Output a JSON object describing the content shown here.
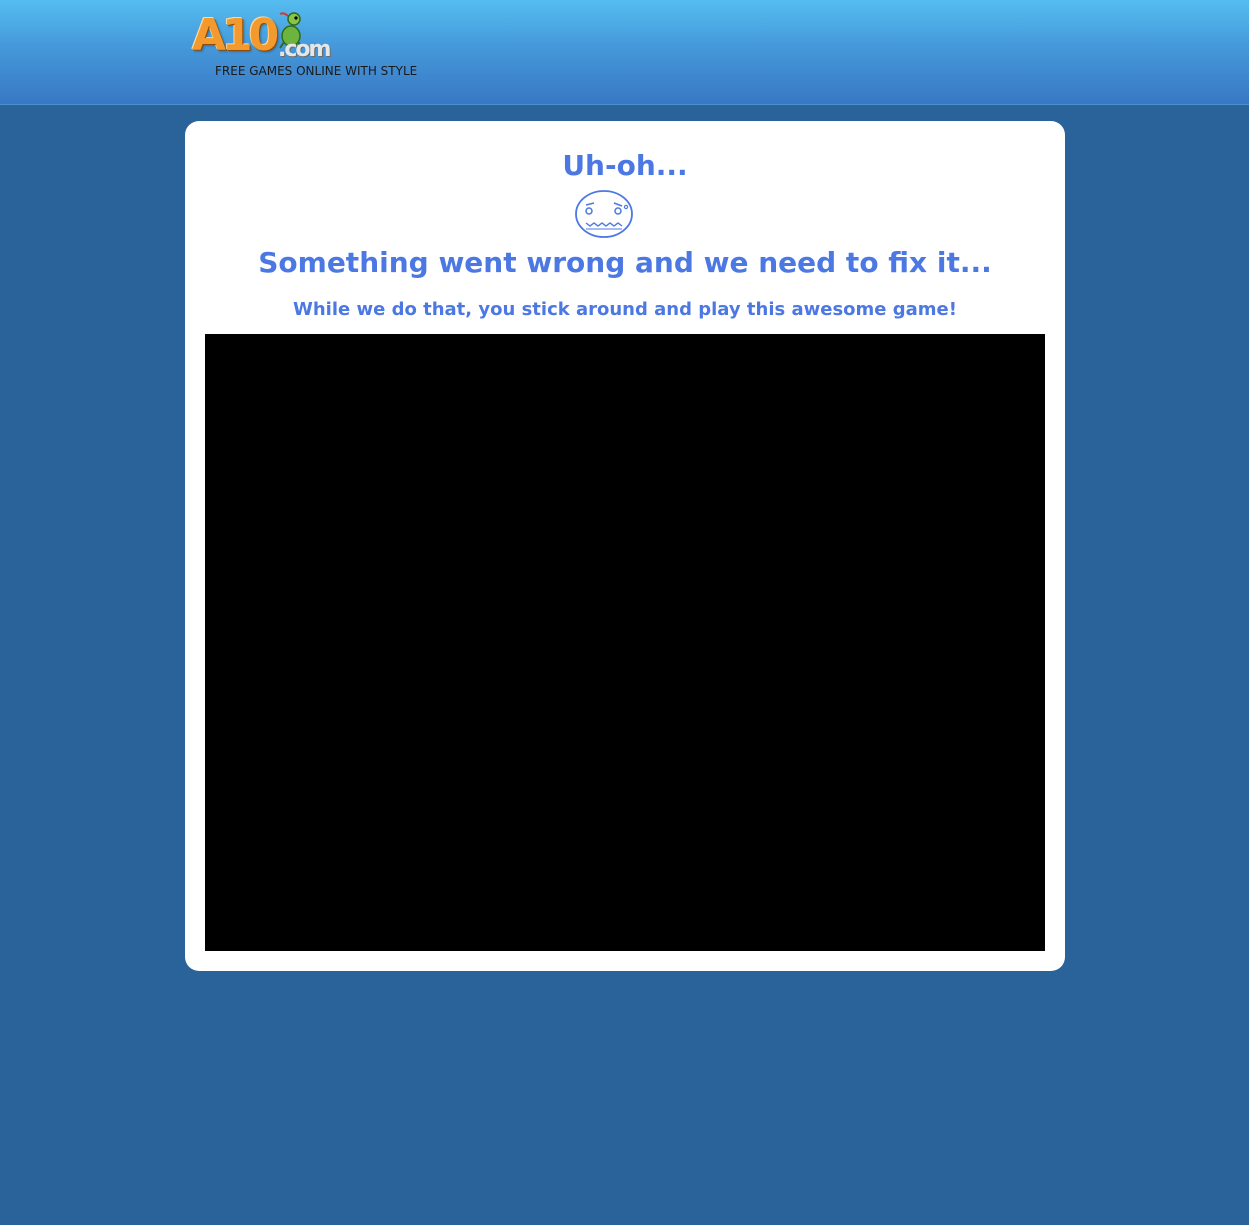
{
  "header": {
    "logo": {
      "name": "A10",
      "suffix": ".com",
      "mascot_icon": "turtle-mascot-icon"
    },
    "tagline": "FREE GAMES ONLINE WITH STYLE"
  },
  "error": {
    "title": "Uh-oh...",
    "face_icon": "worried-face-icon",
    "headline": "Something went wrong and we need to fix it...",
    "subline": "While we do that, you stick around and play this awesome game!"
  },
  "game": {
    "frame": "game-embed"
  },
  "colors": {
    "page_background": "#2a6399",
    "header_top": "#55bdf0",
    "header_bottom": "#3878c4",
    "accent_text": "#4c78e4",
    "card_background": "#ffffff",
    "game_background": "#000000",
    "logo_orange": "#f39a2e"
  }
}
